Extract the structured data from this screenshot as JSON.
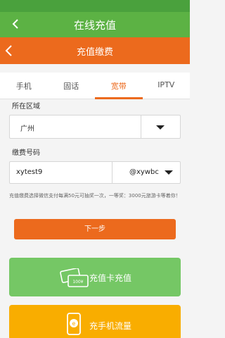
{
  "app_header": {
    "title": "在线充值",
    "back_icon": "chevron-left-icon"
  },
  "sub_header": {
    "title": "充值缴费",
    "back_icon": "chevron-left-icon"
  },
  "tabs": [
    {
      "label": "手机",
      "active": false
    },
    {
      "label": "固话",
      "active": false
    },
    {
      "label": "宽带",
      "active": true
    },
    {
      "label": "IPTV",
      "active": false
    }
  ],
  "region": {
    "label": "所在区域",
    "value": "广州"
  },
  "account": {
    "label": "缴费号码",
    "value": "xytest9",
    "suffix": "@xywbc"
  },
  "notice": "充值缴费选择微信支付每满50元可抽奖一次，一等奖：3000元旅游卡等着你！",
  "next_button": "下一步",
  "recharge_card_button": {
    "label": "充值卡充值",
    "icon": "recharge-card-icon",
    "card_text": "100¥"
  },
  "data_button": {
    "label": "充手机流量",
    "icon": "mobile-data-icon"
  },
  "colors": {
    "status_bar": "#4aa13d",
    "header_green": "#5cb244",
    "accent_orange": "#ec6a1d",
    "button_green": "#75c765",
    "button_yellow": "#f9ad00"
  }
}
